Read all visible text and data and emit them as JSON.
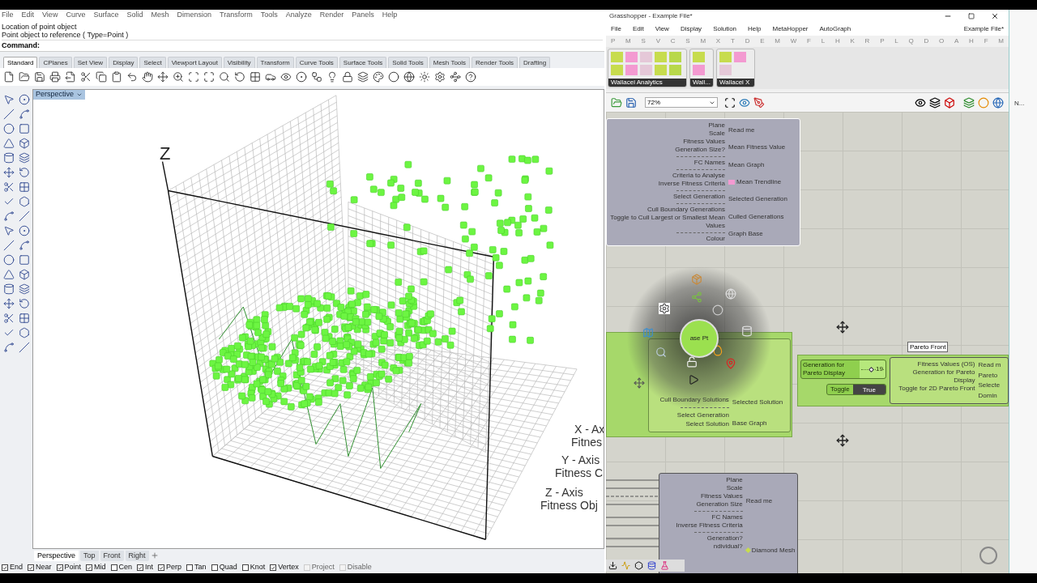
{
  "rhino": {
    "menu": [
      "File",
      "Edit",
      "View",
      "Curve",
      "Surface",
      "Solid",
      "Mesh",
      "Dimension",
      "Transform",
      "Tools",
      "Analyze",
      "Render",
      "Panels",
      "Help"
    ],
    "command_history": [
      "Location of point object",
      "Point object to reference ( Type=Point )"
    ],
    "command_prompt": "Command:",
    "toolbar_tabs": [
      {
        "label": "Standard",
        "selected": true
      },
      {
        "label": "CPlanes",
        "selected": false
      },
      {
        "label": "Set View",
        "selected": false
      },
      {
        "label": "Display",
        "selected": false
      },
      {
        "label": "Select",
        "selected": false
      },
      {
        "label": "Viewport Layout",
        "selected": false
      },
      {
        "label": "Visibility",
        "selected": false
      },
      {
        "label": "Transform",
        "selected": false
      },
      {
        "label": "Curve Tools",
        "selected": false
      },
      {
        "label": "Surface Tools",
        "selected": false
      },
      {
        "label": "Solid Tools",
        "selected": false
      },
      {
        "label": "Mesh Tools",
        "selected": false
      },
      {
        "label": "Render Tools",
        "selected": false
      },
      {
        "label": "Drafting",
        "selected": false
      }
    ],
    "viewport": {
      "title": "Perspective",
      "z_label": "Z",
      "axis_labels": [
        "X - Ax",
        "Fitnes",
        "Y - Axis",
        "Fitness C",
        "Z - Axis",
        "Fitness Obj"
      ]
    },
    "viewport_tabs": [
      {
        "label": "Perspective",
        "selected": true
      },
      {
        "label": "Top",
        "selected": false
      },
      {
        "label": "Front",
        "selected": false
      },
      {
        "label": "Right",
        "selected": false
      }
    ],
    "osnaps": [
      {
        "label": "End",
        "checked": true,
        "disabled": false
      },
      {
        "label": "Near",
        "checked": true,
        "disabled": false
      },
      {
        "label": "Point",
        "checked": true,
        "disabled": false
      },
      {
        "label": "Mid",
        "checked": true,
        "disabled": false
      },
      {
        "label": "Cen",
        "checked": false,
        "disabled": false
      },
      {
        "label": "Int",
        "checked": true,
        "disabled": false
      },
      {
        "label": "Perp",
        "checked": true,
        "disabled": false
      },
      {
        "label": "Tan",
        "checked": false,
        "disabled": false
      },
      {
        "label": "Quad",
        "checked": false,
        "disabled": false
      },
      {
        "label": "Knot",
        "checked": false,
        "disabled": false
      },
      {
        "label": "Vertex",
        "checked": true,
        "disabled": false
      },
      {
        "label": "Project",
        "checked": false,
        "disabled": true
      },
      {
        "label": "Disable",
        "checked": false,
        "disabled": true
      }
    ]
  },
  "grasshopper": {
    "title": "Grasshopper - Example File*",
    "menu": [
      "File",
      "Edit",
      "View",
      "Display",
      "Solution",
      "Help",
      "MetaHopper",
      "AutoGraph"
    ],
    "document_name": "Example File*",
    "category_tabs": [
      "P",
      "M",
      "S",
      "V",
      "C",
      "S",
      "M",
      "X",
      "T",
      "D",
      "E",
      "M",
      "W",
      "F",
      "L",
      "H",
      "K",
      "R",
      "P",
      "L",
      "Q",
      "D",
      "O",
      "A",
      "H",
      "F",
      "M"
    ],
    "ribbon_groups": [
      {
        "label": "Wallacei Analytics"
      },
      {
        "label": "Wall..."
      },
      {
        "label": "Wallacei X"
      }
    ],
    "zoom": "72%",
    "analysis_component": {
      "inputs": [
        {
          "kind": "param",
          "label": "Plane"
        },
        {
          "kind": "param",
          "label": "Scale"
        },
        {
          "kind": "param",
          "label": "Fitness Values"
        },
        {
          "kind": "param",
          "label": "Generation Size?"
        },
        {
          "kind": "separator"
        },
        {
          "kind": "param",
          "label": "FC Names"
        },
        {
          "kind": "separator"
        },
        {
          "kind": "param",
          "label": "Criteria to Analyse"
        },
        {
          "kind": "param",
          "label": "Inverse Fitness Criteria"
        },
        {
          "kind": "separator"
        },
        {
          "kind": "param",
          "label": "Select Generation"
        },
        {
          "kind": "separator"
        },
        {
          "kind": "param",
          "label": "Cull Boundary Generations"
        },
        {
          "kind": "param",
          "label": "Toggle to Cull Largest or Smallest Mean Values"
        },
        {
          "kind": "separator"
        },
        {
          "kind": "param",
          "label": "Colour"
        }
      ],
      "outputs": [
        {
          "kind": "param",
          "label": "Read me"
        },
        {
          "kind": "param",
          "label": "Mean Fitness Value"
        },
        {
          "kind": "param",
          "label": "Mean Graph"
        },
        {
          "kind": "swatch",
          "label": "Mean Trendline"
        },
        {
          "kind": "param",
          "label": "Selected Generation"
        },
        {
          "kind": "param",
          "label": "Culled Generations"
        },
        {
          "kind": "param",
          "label": "Graph Base"
        }
      ]
    },
    "solution_component": {
      "inputs": [
        {
          "kind": "param",
          "label": "Cull Boundary Solutions"
        },
        {
          "kind": "separator"
        },
        {
          "kind": "param",
          "label": "Select Generation"
        },
        {
          "kind": "param",
          "label": "Select Solution"
        }
      ],
      "outputs": [
        {
          "label": "Selected Solution"
        },
        {
          "label": "Base Graph"
        }
      ]
    },
    "radial_menu": {
      "center_label": "ase Pt"
    },
    "pareto_group": {
      "tooltip": "Pareto Front",
      "slider": {
        "label": "Generation for Pareto Display",
        "value": "19",
        "level": 0.45
      },
      "toggle": {
        "label": "Toggle",
        "value": "True"
      },
      "inputs": [
        {
          "kind": "param",
          "label": "Fitness Values (OS)"
        },
        {
          "kind": "param",
          "label": "Generation for Pareto Display"
        },
        {
          "kind": "param",
          "label": "Toggle for 2D Pareto Front"
        }
      ],
      "outputs": [
        {
          "kind": "param",
          "label": "Read m"
        },
        {
          "kind": "param",
          "label": "Pareto"
        },
        {
          "kind": "param",
          "label": "Selecte"
        },
        {
          "kind": "param",
          "label": "Domin"
        }
      ]
    },
    "diamond_component": {
      "inputs": [
        {
          "kind": "param",
          "label": "Plane"
        },
        {
          "kind": "param",
          "label": "Scale"
        },
        {
          "kind": "param",
          "label": "Fitness Values"
        },
        {
          "kind": "param",
          "label": "Generation Size"
        },
        {
          "kind": "separator"
        },
        {
          "kind": "param",
          "label": "FC Names"
        },
        {
          "kind": "param",
          "label": "Inverse Fitness Criteria"
        },
        {
          "kind": "separator"
        },
        {
          "kind": "param",
          "label": "Generation?"
        },
        {
          "kind": "param",
          "label": "ndividual?"
        }
      ],
      "outputs": [
        {
          "kind": "param",
          "label": "Read me"
        },
        {
          "kind": "diamond",
          "label": "Diamond Mesh"
        }
      ]
    }
  },
  "side_panel": {
    "tab": "N..."
  }
}
